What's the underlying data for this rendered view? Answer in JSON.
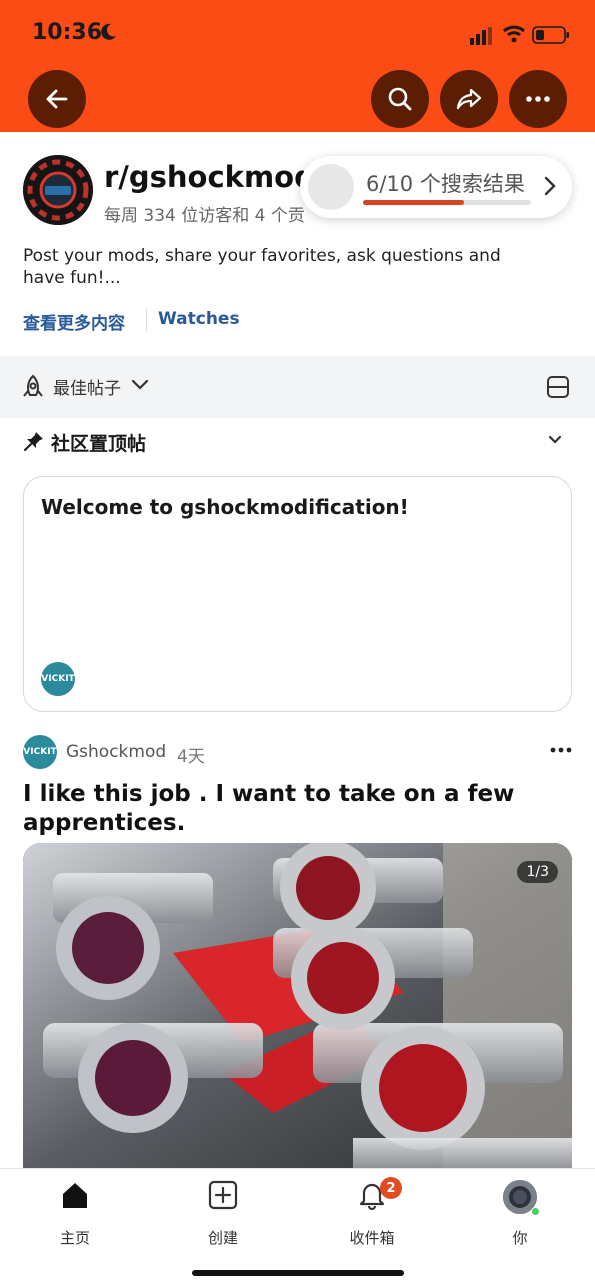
{
  "status_bar": {
    "time": "10:36"
  },
  "community": {
    "name": "r/gshockmodifi",
    "meta": "每周 334 位访客和 4 个贡",
    "description": "Post your mods, share your favorites, ask questions and have fun!...",
    "link_more": "查看更多内容",
    "link_watches": "Watches"
  },
  "search_results": {
    "label": "6/10 个搜索结果",
    "progress": 0.6
  },
  "sort": {
    "label": "最佳帖子"
  },
  "pinned": {
    "title": "社区置顶帖",
    "card_title": "Welcome to gshockmodification!",
    "avatar_text": "VICKIT"
  },
  "post": {
    "avatar_text": "VICKIT",
    "user": "Gshockmod",
    "time": "4天",
    "title": "I like this job . I want to take on a few apprentices.",
    "image_counter": "1/3"
  },
  "bottom_nav": {
    "home": "主页",
    "create": "创建",
    "inbox": "收件箱",
    "inbox_badge": "2",
    "you": "你"
  },
  "colors": {
    "accent": "#fc4c16",
    "button_bg": "#5c1d05",
    "link": "#2a5a9a"
  }
}
